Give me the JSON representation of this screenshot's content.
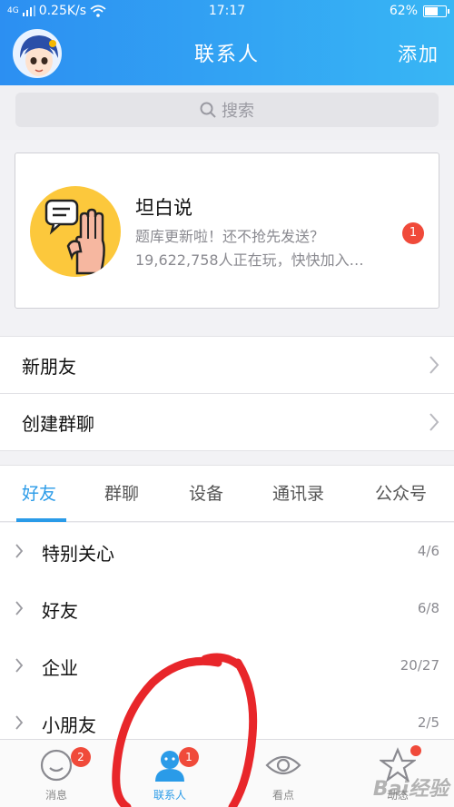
{
  "status": {
    "signal_label": "4G",
    "speed": "0.25K/s",
    "time": "17:17",
    "battery_text": "62%",
    "battery_level": 0.62
  },
  "header": {
    "title": "联系人",
    "add_label": "添加"
  },
  "search": {
    "placeholder": "搜索"
  },
  "promo_card": {
    "title": "坦白说",
    "line1": "题库更新啦！还不抢先发送？",
    "line2": "19,622,758人正在玩，快快加入…",
    "badge": "1"
  },
  "rows": [
    {
      "label": "新朋友"
    },
    {
      "label": "创建群聊"
    }
  ],
  "tabs": [
    {
      "label": "好友",
      "active": true
    },
    {
      "label": "群聊"
    },
    {
      "label": "设备"
    },
    {
      "label": "通讯录"
    },
    {
      "label": "公众号"
    }
  ],
  "groups": [
    {
      "name": "特别关心",
      "count": "4/6"
    },
    {
      "name": "好友",
      "count": "6/8"
    },
    {
      "name": "企业",
      "count": "20/27"
    },
    {
      "name": "小朋友",
      "count": "2/5"
    }
  ],
  "bottom_nav": [
    {
      "label": "消息",
      "badge": "2",
      "icon": "message-icon"
    },
    {
      "label": "联系人",
      "badge": "1",
      "icon": "contacts-icon",
      "active": true
    },
    {
      "label": "看点",
      "icon": "eye-icon"
    },
    {
      "label": "动态",
      "icon": "star-icon"
    }
  ],
  "watermark": "Bai经验",
  "colors": {
    "accent": "#2a9be8",
    "header_start": "#2c8ff2",
    "header_end": "#38b6f4",
    "badge": "#f04a3a",
    "annotation": "#e8262a"
  }
}
